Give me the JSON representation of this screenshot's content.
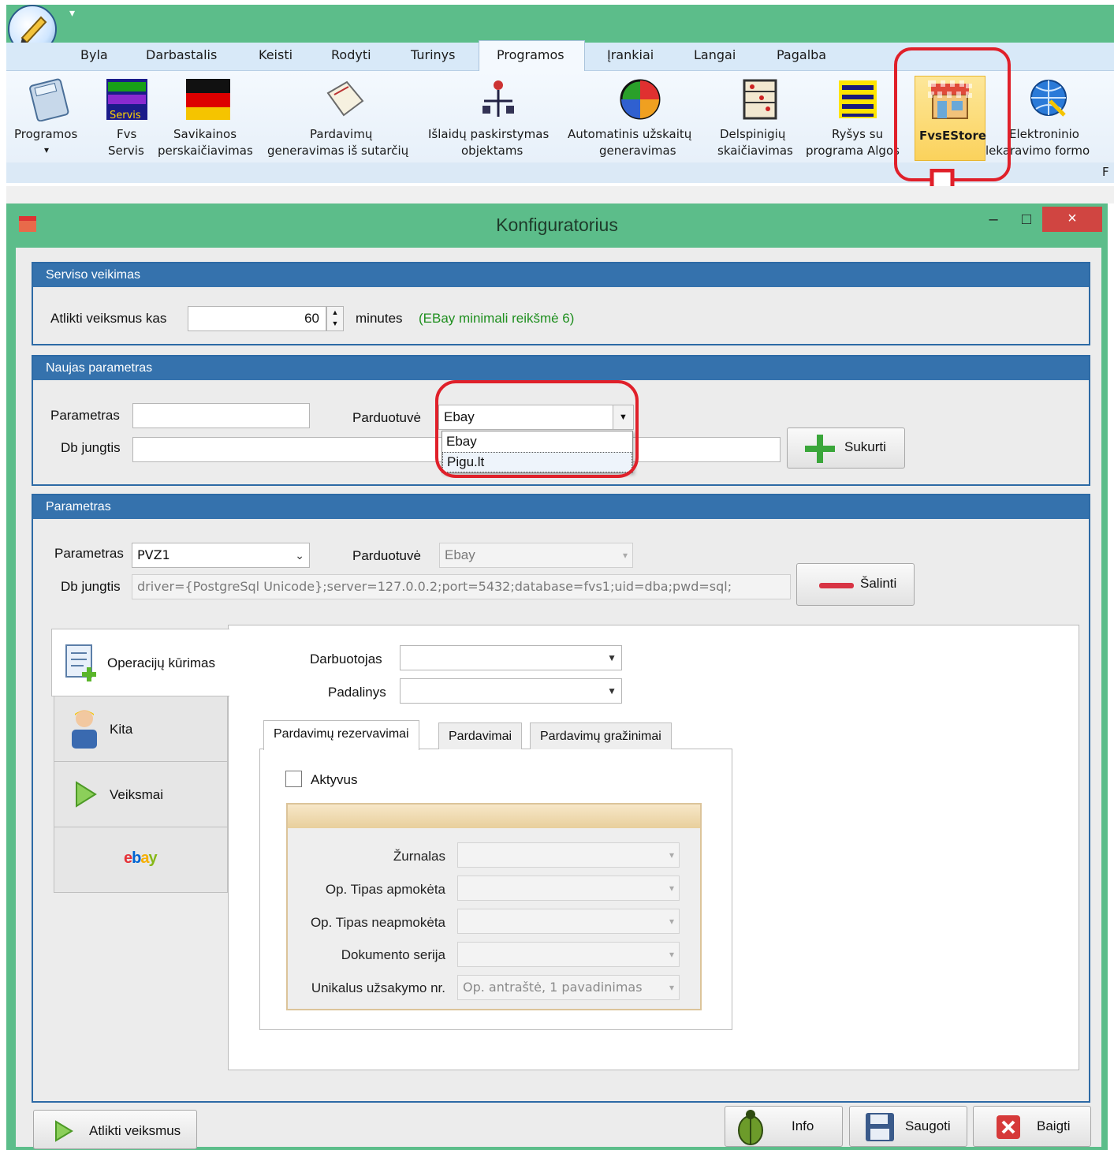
{
  "menu": [
    "Byla",
    "Darbastalis",
    "Keisti",
    "Rodyti",
    "Turinys",
    "Programos",
    "Įrankiai",
    "Langai",
    "Pagalba"
  ],
  "ribbon": [
    {
      "label1": "Programos",
      "label2": "▾"
    },
    {
      "label1": "Fvs",
      "label2": "Servis"
    },
    {
      "label1": "Savikainos",
      "label2": "perskaičiavimas"
    },
    {
      "label1": "Pardavimų",
      "label2": "generavimas iš sutarčių"
    },
    {
      "label1": "Išlaidų paskirstymas",
      "label2": "objektams"
    },
    {
      "label1": "Automatinis užskaitų",
      "label2": "generavimas"
    },
    {
      "label1": "Delspinigių",
      "label2": "skaičiavimas"
    },
    {
      "label1": "Ryšys su",
      "label2": "programa Algos"
    },
    {
      "label1": "FvsEStore",
      "label2": ""
    },
    {
      "label1": "Elektroninio",
      "label2": "lekaravimo formo"
    }
  ],
  "ribbon_footer_letter": "F",
  "dialog": {
    "title": "Konfiguratorius",
    "close": "×",
    "minimize": "–",
    "maximize": "□"
  },
  "service": {
    "header": "Serviso veikimas",
    "label": "Atlikti veiksmus kas",
    "value": "60",
    "unit": "minutes",
    "hint": "(EBay minimali reikšmė 6)",
    "hint_color": "#1f8f1f"
  },
  "newparam": {
    "header": "Naujas parametras",
    "param_label": "Parametras",
    "param_value": "",
    "db_label": "Db jungtis",
    "db_value": "",
    "store_label": "Parduotuvė",
    "store_value": "Ebay",
    "options": [
      "Ebay",
      "Pigu.lt"
    ],
    "create_button": "Sukurti"
  },
  "param": {
    "header": "Parametras",
    "param_label": "Parametras",
    "param_value": "PVZ1",
    "store_label": "Parduotuvė",
    "store_value": "Ebay",
    "db_label": "Db jungtis",
    "db_value": "driver={PostgreSql Unicode};server=127.0.0.2;port=5432;database=fvs1;uid=dba;pwd=sql;",
    "delete_button": "Šalinti"
  },
  "side_tabs": [
    "Operacijų kūrimas",
    "Kita",
    "Veiksmai",
    "ebay"
  ],
  "ops": {
    "employee_label": "Darbuotojas",
    "employee_value": "",
    "unit_label": "Padalinys",
    "unit_value": "",
    "tabs": [
      "Pardavimų rezervavimai",
      "Pardavimai",
      "Pardavimų gražinimai"
    ],
    "active_label": "Aktyvus",
    "active_checked": false,
    "fields": [
      {
        "label": "Žurnalas",
        "value": ""
      },
      {
        "label": "Op. Tipas apmokėta",
        "value": ""
      },
      {
        "label": "Op. Tipas neapmokėta",
        "value": ""
      },
      {
        "label": "Dokumento serija",
        "value": ""
      },
      {
        "label": "Unikalus užsakymo nr.",
        "value": "Op. antraštė, 1 pavadinimas"
      }
    ]
  },
  "bottom": {
    "run": "Atlikti veiksmus",
    "info": "Info",
    "save": "Saugoti",
    "close": "Baigti"
  },
  "colors": {
    "accent": "#5cbd8a",
    "header": "#3572ad",
    "highlight": "#e0202a"
  }
}
